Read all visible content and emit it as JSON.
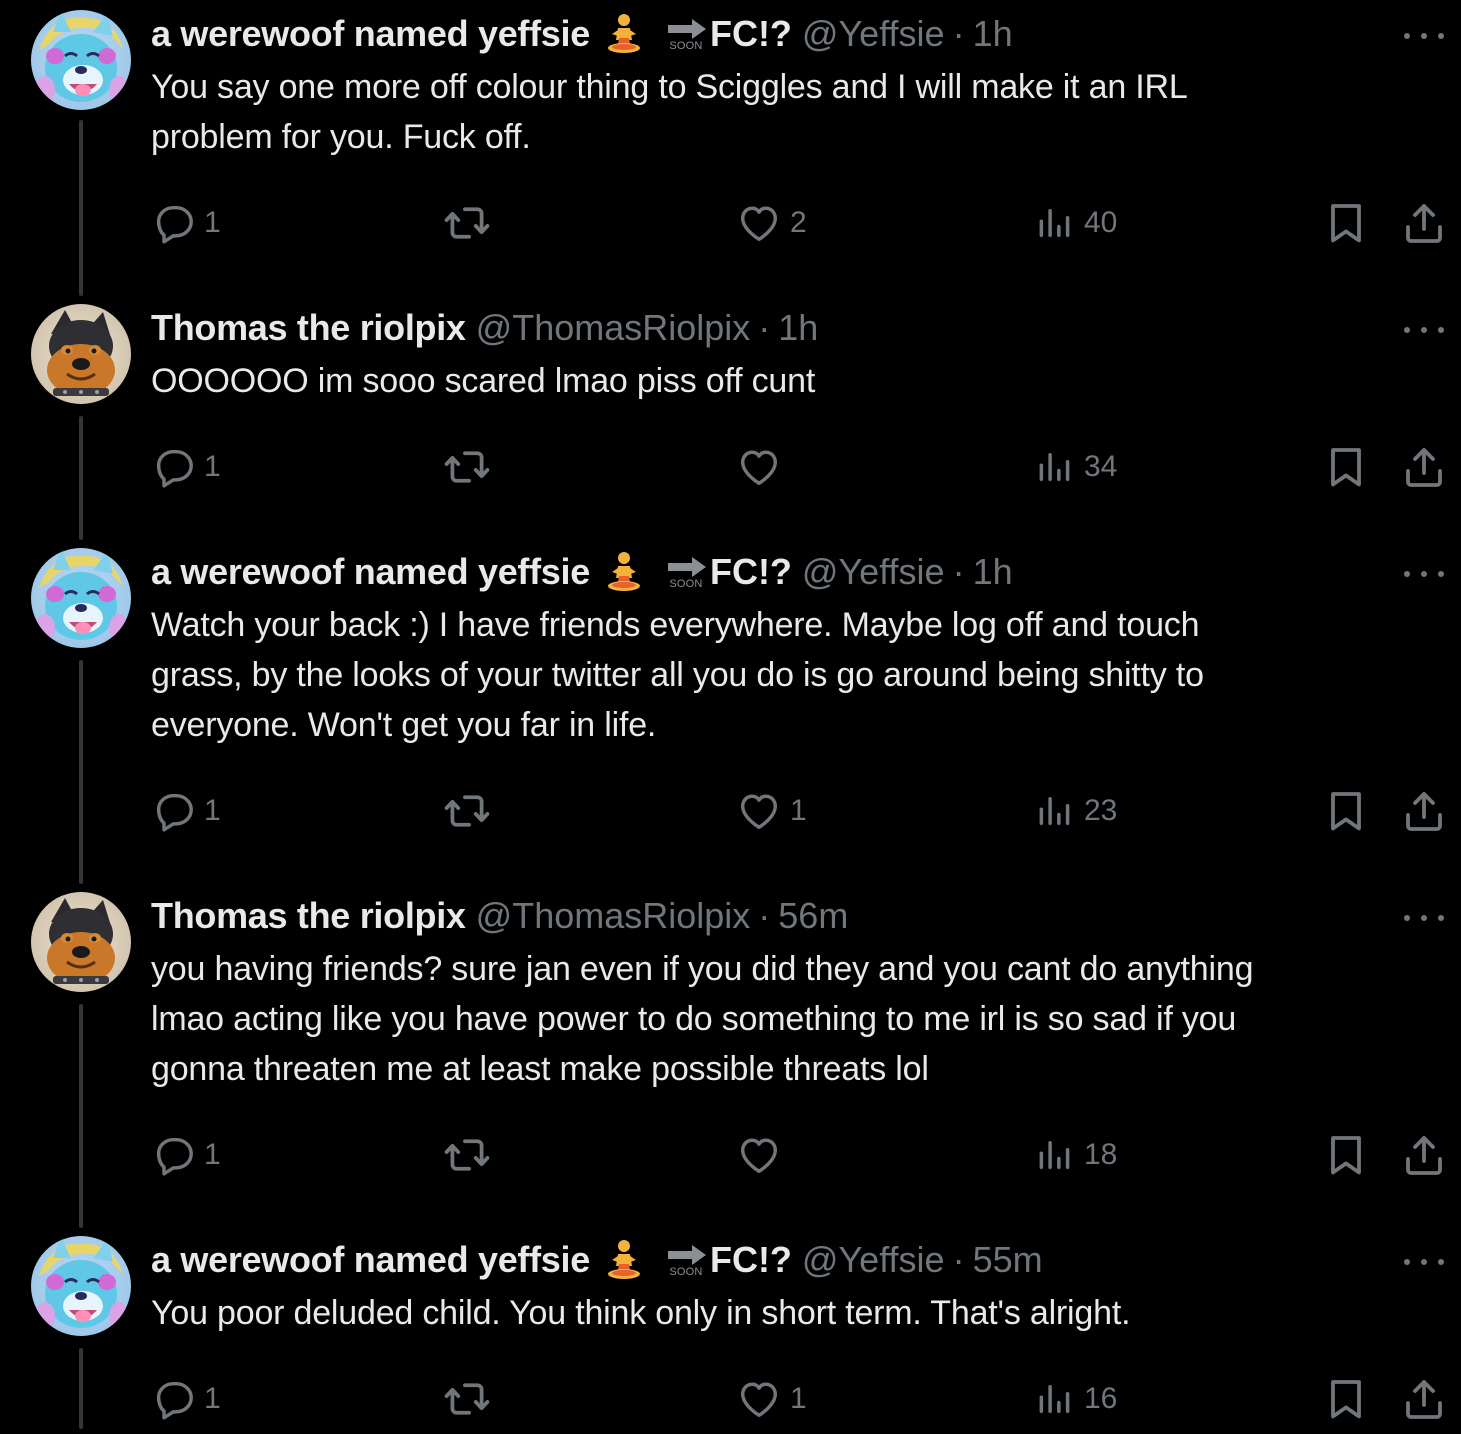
{
  "colors": {
    "background": "#000000",
    "text": "#e7e9ea",
    "secondary": "#71767b",
    "thread_line": "#333639"
  },
  "tweets": [
    {
      "display_name": "a werewoof named yeffsie",
      "emoji": "person-in-lotus-position",
      "badge_soon": "SOON",
      "badge_suffix": "FC!?",
      "handle": "@Yeffsie",
      "separator": "·",
      "time": "1h",
      "avatar": "blue-wolf-avatar",
      "text": "You say one more off colour thing to Sciggles and I will make it an IRL\nproblem for you. Fuck off.",
      "replies": "1",
      "retweets": "",
      "likes": "2",
      "views": "40"
    },
    {
      "display_name": "Thomas the riolpix",
      "handle": "@ThomasRiolpix",
      "separator": "·",
      "time": "1h",
      "avatar": "dog-avatar",
      "text": "OOOOOO im sooo scared lmao piss off cunt",
      "replies": "1",
      "retweets": "",
      "likes": "",
      "views": "34"
    },
    {
      "display_name": "a werewoof named yeffsie",
      "emoji": "person-in-lotus-position",
      "badge_soon": "SOON",
      "badge_suffix": "FC!?",
      "handle": "@Yeffsie",
      "separator": "·",
      "time": "1h",
      "avatar": "blue-wolf-avatar",
      "text": "Watch your back :) I have friends everywhere. Maybe log off and touch\ngrass, by the looks of your twitter all you do is go around being shitty to\neveryone. Won't get you far in life.",
      "replies": "1",
      "retweets": "",
      "likes": "1",
      "views": "23"
    },
    {
      "display_name": "Thomas the riolpix",
      "handle": "@ThomasRiolpix",
      "separator": "·",
      "time": "56m",
      "avatar": "dog-avatar",
      "text": "you having friends? sure jan even if you did they and you cant do anything\nlmao acting like you have power to do something to me irl is so sad if you\ngonna threaten me at least make possible threats lol",
      "replies": "1",
      "retweets": "",
      "likes": "",
      "views": "18"
    },
    {
      "display_name": "a werewoof named yeffsie",
      "emoji": "person-in-lotus-position",
      "badge_soon": "SOON",
      "badge_suffix": "FC!?",
      "handle": "@Yeffsie",
      "separator": "·",
      "time": "55m",
      "avatar": "blue-wolf-avatar",
      "text": "You poor deluded child. You think only in short term. That's alright.",
      "replies": "1",
      "retweets": "",
      "likes": "1",
      "views": "16"
    }
  ]
}
